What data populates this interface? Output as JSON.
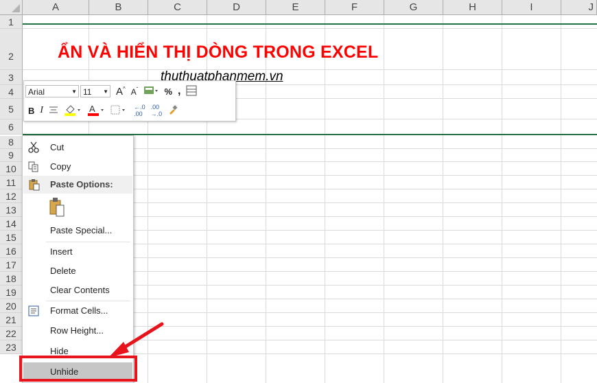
{
  "columns": [
    "A",
    "B",
    "C",
    "D",
    "E",
    "F",
    "G",
    "H",
    "I",
    "J"
  ],
  "rows": [
    "1",
    "2",
    "3",
    "4",
    "5",
    "6",
    "8",
    "9",
    "10",
    "11",
    "12",
    "13",
    "14",
    "15",
    "16",
    "17",
    "18",
    "19",
    "20",
    "21",
    "22",
    "23"
  ],
  "cells": {
    "title": "ẨN VÀ HIỂN THỊ DÒNG TRONG EXCEL",
    "subtitle": "thuthuatphanmem.vn"
  },
  "mini_toolbar": {
    "font_name": "Arial",
    "font_size": "11",
    "percent": "%",
    "comma": ",",
    "bold": "B",
    "italic": "I",
    "inc_decimal": "←.0 .00",
    "dec_decimal": ".00 →.0"
  },
  "context_menu": {
    "cut": "Cut",
    "copy": "Copy",
    "paste_options": "Paste Options:",
    "paste_special": "Paste Special...",
    "insert": "Insert",
    "delete": "Delete",
    "clear_contents": "Clear Contents",
    "format_cells": "Format Cells...",
    "row_height": "Row Height...",
    "hide": "Hide",
    "unhide": "Unhide"
  },
  "colors": {
    "title_red": "#ff0000",
    "excel_green": "#217346",
    "annotation_red": "#e8141b",
    "highlight_grey": "#c6c6c6"
  }
}
